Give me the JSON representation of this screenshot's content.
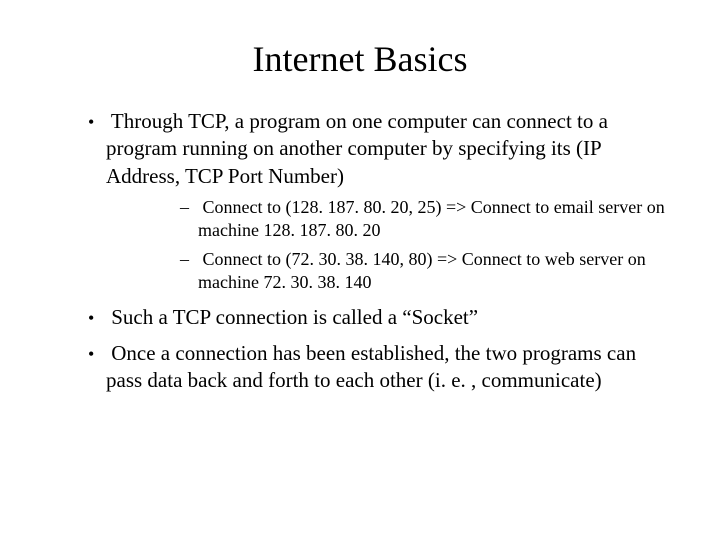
{
  "slide": {
    "title": "Internet Basics",
    "bullets": {
      "b1": "Through TCP, a program on one computer can connect to a program running on another computer by specifying its (IP Address, TCP Port Number)",
      "b1_sub": {
        "s1": "Connect to (128. 187. 80. 20, 25)  => Connect to email server on machine 128. 187. 80. 20",
        "s2": "Connect to (72. 30. 38. 140, 80) => Connect to web server on machine 72. 30. 38. 140"
      },
      "b2": "Such a TCP connection is called a “Socket”",
      "b3": "Once a connection has been established, the two programs can pass data back and forth to each other (i. e. , communicate)"
    }
  }
}
